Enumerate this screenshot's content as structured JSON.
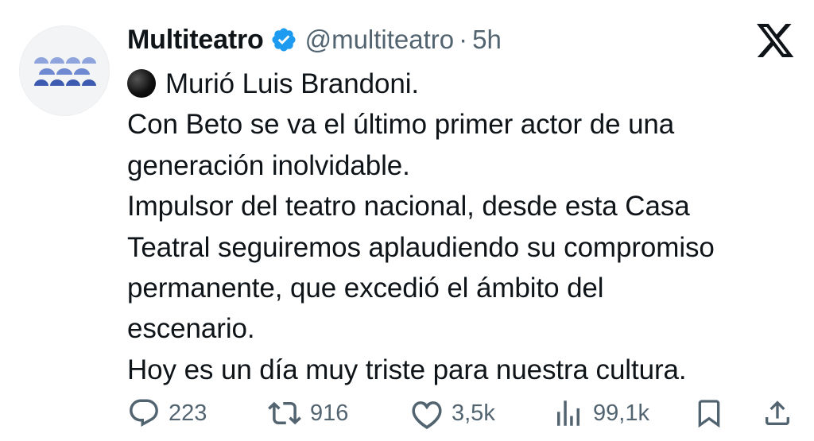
{
  "account": {
    "display_name": "Multiteatro",
    "handle": "@multiteatro",
    "separator": "·",
    "time": "5h",
    "avatar_icon": "theater-seats-logo",
    "verified_icon": "verified-badge-icon",
    "verified_color": "#1d9bf0"
  },
  "platform_icon": "x-logo",
  "tweet": {
    "emoji": "black-circle",
    "lines": [
      "Murió Luis Brandoni.",
      "Con Beto se va el último primer actor de una",
      "generación inolvidable.",
      "Impulsor del teatro nacional, desde esta Casa",
      "Teatral seguiremos aplaudiendo su compromiso",
      "permanente, que excedió el ámbito del",
      "escenario.",
      "Hoy es un día muy triste para nuestra cultura."
    ]
  },
  "actions": {
    "replies": "223",
    "reposts": "916",
    "likes": "3,5k",
    "views": "99,1k"
  },
  "colors": {
    "text": "#0f1419",
    "muted": "#536471",
    "logo_light": "#8fa4dd",
    "logo_dark": "#3d5bb0"
  }
}
